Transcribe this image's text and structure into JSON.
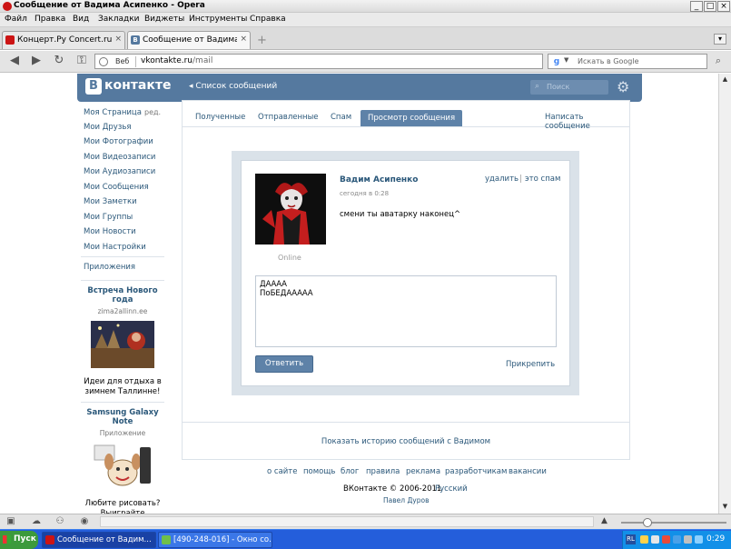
{
  "window": {
    "title": "Сообщение от Вадима Асипенко - Opera",
    "buttons": [
      "_",
      "□",
      "×"
    ]
  },
  "menu": [
    "Файл",
    "Правка",
    "Вид",
    "Закладки",
    "Виджеты",
    "Инструменты",
    "Справка"
  ],
  "tabs": [
    {
      "label": "Концерт.Ру Concert.ru ...",
      "icon": "opera-icon",
      "close": "×"
    },
    {
      "label": "Сообщение от Вадима ...",
      "icon": "vk-favicon",
      "icon_text": "B",
      "close": "×"
    }
  ],
  "tab_add": "+",
  "tab_menu": "▾",
  "toolbar": {
    "address_label": "Веб",
    "url_host": "vkontakte.ru",
    "url_path": "/mail",
    "search_placeholder": "Искать в Google",
    "search_engine_letter": "g"
  },
  "vk": {
    "logo_letter": "B",
    "logo_text": "контакте",
    "back_link": "◂ Список сообщений",
    "search_placeholder": "Поиск",
    "search_icon": "⌕",
    "gear_icon": "⚙",
    "accent_color": "#55799f",
    "link_color": "#2b587a"
  },
  "sidebar": {
    "items": [
      "Моя Страница",
      "Мои Друзья",
      "Мои Фотографии",
      "Мои Видеозаписи",
      "Мои Аудиозаписи",
      "Мои Сообщения",
      "Мои Заметки",
      "Мои Группы",
      "Мои Новости",
      "Мои Настройки"
    ],
    "edit_label": "ред.",
    "apps_label": "Приложения",
    "ads": [
      {
        "title": "Встреча Нового года",
        "subtitle": "zima2allinn.ee",
        "desc": "Идеи для отдыха в зимнем Таллинне!"
      },
      {
        "title": "Samsung Galaxy Note",
        "subtitle": "Приложение",
        "desc": "Любите рисовать? Выиграйте смартфон"
      }
    ]
  },
  "mail_tabs": {
    "received": "Полученные",
    "sent": "Отправленные",
    "spam": "Спам",
    "view": "Просмотр сообщения",
    "write": "Написать сообщение"
  },
  "message": {
    "sender": "Вадим Асипенко",
    "time": "сегодня в 0:28",
    "text": "смени ты аватарку наконец^",
    "status": "Online",
    "delete_label": "удалить",
    "separator": "|",
    "spam_label": "это спам",
    "reply_text": "ДАААА\nПоБЕДААААА",
    "reply_button": "Ответить",
    "attach_label": "Прикрепить"
  },
  "history_link": "Показать историю сообщений с Вадимом",
  "footer": {
    "links": [
      "о сайте",
      "помощь",
      "блог",
      "правила",
      "реклама",
      "разработчикам",
      "вакансии"
    ],
    "copyright": "ВКонтакте © 2006-2011",
    "language": "Русский",
    "author": "Павел Дуров"
  },
  "statusbar": {
    "icons": [
      "panel-icon",
      "cloud-icon",
      "unite-icon",
      "turbo-icon"
    ],
    "view_toggle": "▲",
    "zoom_level": 0.25
  },
  "taskbar": {
    "start_label": "Пуск",
    "tasks": [
      {
        "label": "Сообщение от Вадим...",
        "active": true,
        "icon_color": "#cc1414"
      },
      {
        "label": "[490-248-016] - Окно со...",
        "active": false,
        "icon_color": "#6fbf4a"
      }
    ],
    "tray_lang": "RL",
    "clock": "0:29"
  }
}
